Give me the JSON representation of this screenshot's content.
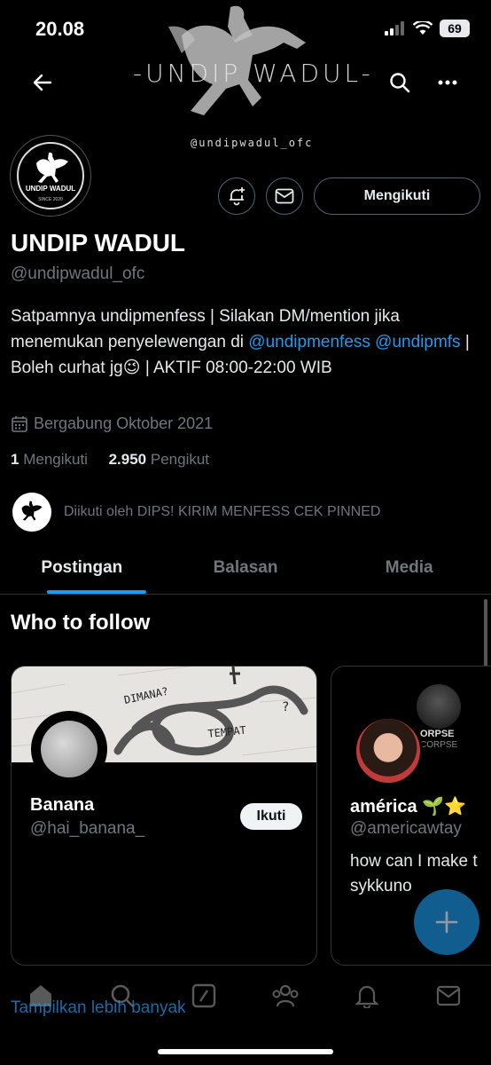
{
  "status_bar": {
    "time": "20.08",
    "battery": "69"
  },
  "banner": {
    "title": "-UNDIP WADUL-",
    "handle": "@undipwadul_ofc"
  },
  "avatar": {
    "name": "UNDIP WADUL",
    "since": "SINCE 2020"
  },
  "profile": {
    "name": "UNDIP WADUL",
    "handle": "@undipwadul_ofc",
    "follow_state_label": "Mengikuti",
    "bio": {
      "part1": "Satpamnya undipmenfess | Silakan DM/mention jika menemukan penyelewengan di ",
      "mention1": "@undipmenfess",
      "space": " ",
      "mention2": "@undipmfs",
      "part2": " | Boleh curhat jg😉 | AKTIF 08:00-22:00 WIB"
    },
    "joined": "Bergabung Oktober 2021",
    "following_count": "1",
    "following_label": "Mengikuti",
    "followers_count": "2.950",
    "followers_label": "Pengikut"
  },
  "followed_by": {
    "text": "Diikuti oleh DIPS! KIRIM MENFESS CEK PINNED"
  },
  "tabs": [
    {
      "label": "Postingan",
      "active": true
    },
    {
      "label": "Balasan",
      "active": false
    },
    {
      "label": "Media",
      "active": false
    }
  ],
  "who_to_follow": {
    "title": "Who to follow",
    "cards": [
      {
        "name": "Banana",
        "handle": "@hai_banana_",
        "button": "Ikuti",
        "banner_words": [
          "DIMANA?",
          "TEMPAT",
          "?"
        ]
      },
      {
        "name": "américa 🌱⭐",
        "handle": "@americawtay",
        "description": "how can I make t sykkuno",
        "badge_text": "ORPSE",
        "badge_sub": "CORPSE"
      }
    ],
    "show_more": "Tampilkan lebih banyak"
  },
  "colors": {
    "accent": "#1d9bf0",
    "background": "#000000",
    "muted": "#71767b"
  },
  "icons": [
    "back-arrow-icon",
    "search-icon",
    "more-icon",
    "bell-plus-icon",
    "mail-icon",
    "calendar-icon",
    "plus-icon",
    "home-icon",
    "grok-icon",
    "people-icon",
    "bell-icon"
  ]
}
